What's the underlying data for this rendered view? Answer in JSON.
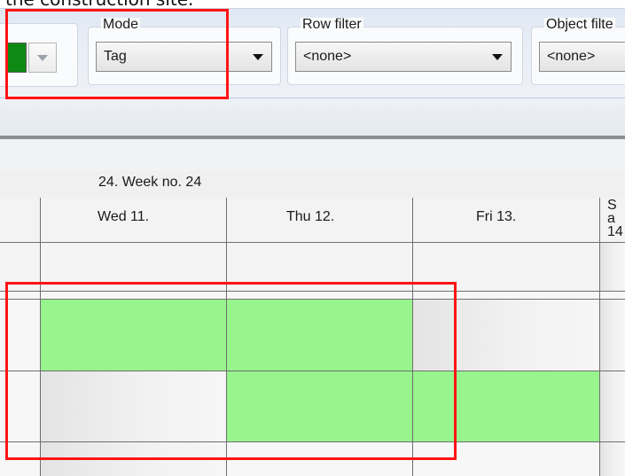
{
  "caption": "the construction site.",
  "toolbar": {
    "color_picker": {
      "swatch_color": "#0e8a14"
    },
    "mode": {
      "label": "Mode",
      "value": "Tag"
    },
    "row_filter": {
      "label": "Row filter",
      "value": "<none>"
    },
    "object_filter": {
      "label": "Object filte",
      "value": "<none>"
    }
  },
  "schedule": {
    "week_label": "24. Week no. 24",
    "days": [
      {
        "label": "Wed 11."
      },
      {
        "label": "Thu 12."
      },
      {
        "label": "Fri 13."
      },
      {
        "label": "Sa 14"
      }
    ],
    "bar_color": "#98f48d"
  },
  "highlight_color": "#ff1414"
}
